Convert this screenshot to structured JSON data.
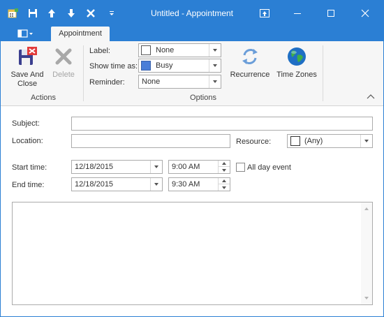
{
  "window": {
    "title": "Untitled - Appointment",
    "accent_color": "#2b7fd4"
  },
  "quick_access": [
    "appointment-icon",
    "save-icon",
    "arrow-up-icon",
    "arrow-down-icon",
    "delete-icon",
    "customize-dropdown-icon"
  ],
  "tabs": {
    "active": "Appointment"
  },
  "ribbon": {
    "actions": {
      "group_label": "Actions",
      "save_and_close": "Save And Close",
      "delete": "Delete"
    },
    "options": {
      "group_label": "Options",
      "label_label": "Label:",
      "label_value": "None",
      "label_color": "#ffffff",
      "show_time_as_label": "Show time as:",
      "show_time_as_value": "Busy",
      "show_time_as_color": "#4a7ed8",
      "reminder_label": "Reminder:",
      "reminder_value": "None",
      "recurrence": "Recurrence",
      "time_zones": "Time Zones"
    }
  },
  "form": {
    "subject_label": "Subject:",
    "subject_value": "",
    "location_label": "Location:",
    "location_value": "",
    "resource_label": "Resource:",
    "resource_value": "(Any)",
    "start_label": "Start time:",
    "start_date": "12/18/2015",
    "start_time": "9:00 AM",
    "end_label": "End time:",
    "end_date": "12/18/2015",
    "end_time": "9:30 AM",
    "all_day_label": "All day event",
    "all_day_checked": false,
    "notes": ""
  }
}
